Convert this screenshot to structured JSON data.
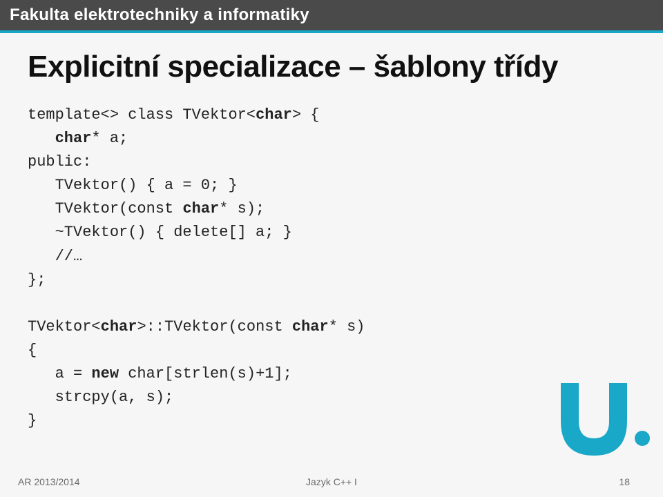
{
  "header": {
    "title": "Fakulta elektrotechniky a informatiky"
  },
  "slide": {
    "title": "Explicitní specializace – šablony třídy",
    "code": {
      "l1_a": "template<> class TVektor<",
      "l1_b": "char",
      "l1_c": "> {",
      "l2_pad": "   ",
      "l2_a": "char",
      "l2_b": "* a;",
      "l3": "public:",
      "l4": "   TVektor() { a = 0; }",
      "l5_pad": "   TVektor(const ",
      "l5_a": "char",
      "l5_b": "* s);",
      "l6": "   ~TVektor() { delete[] a; }",
      "l7": "   //…",
      "l8": "};",
      "blank": "",
      "l10_a": "TVektor<",
      "l10_b": "char",
      "l10_c": ">::TVektor(const ",
      "l10_d": "char",
      "l10_e": "* s)",
      "l11": "{",
      "l12_pad": "   a = ",
      "l12_a": "new",
      "l12_b": " char[strlen(s)+1];",
      "l13": "   strcpy(a, s);",
      "l14": "}"
    }
  },
  "footer": {
    "left": "AR 2013/2014",
    "center": "Jazyk C++ I",
    "right": "18"
  },
  "colors": {
    "accent": "#19a8c7",
    "header": "#4a4a4a"
  }
}
